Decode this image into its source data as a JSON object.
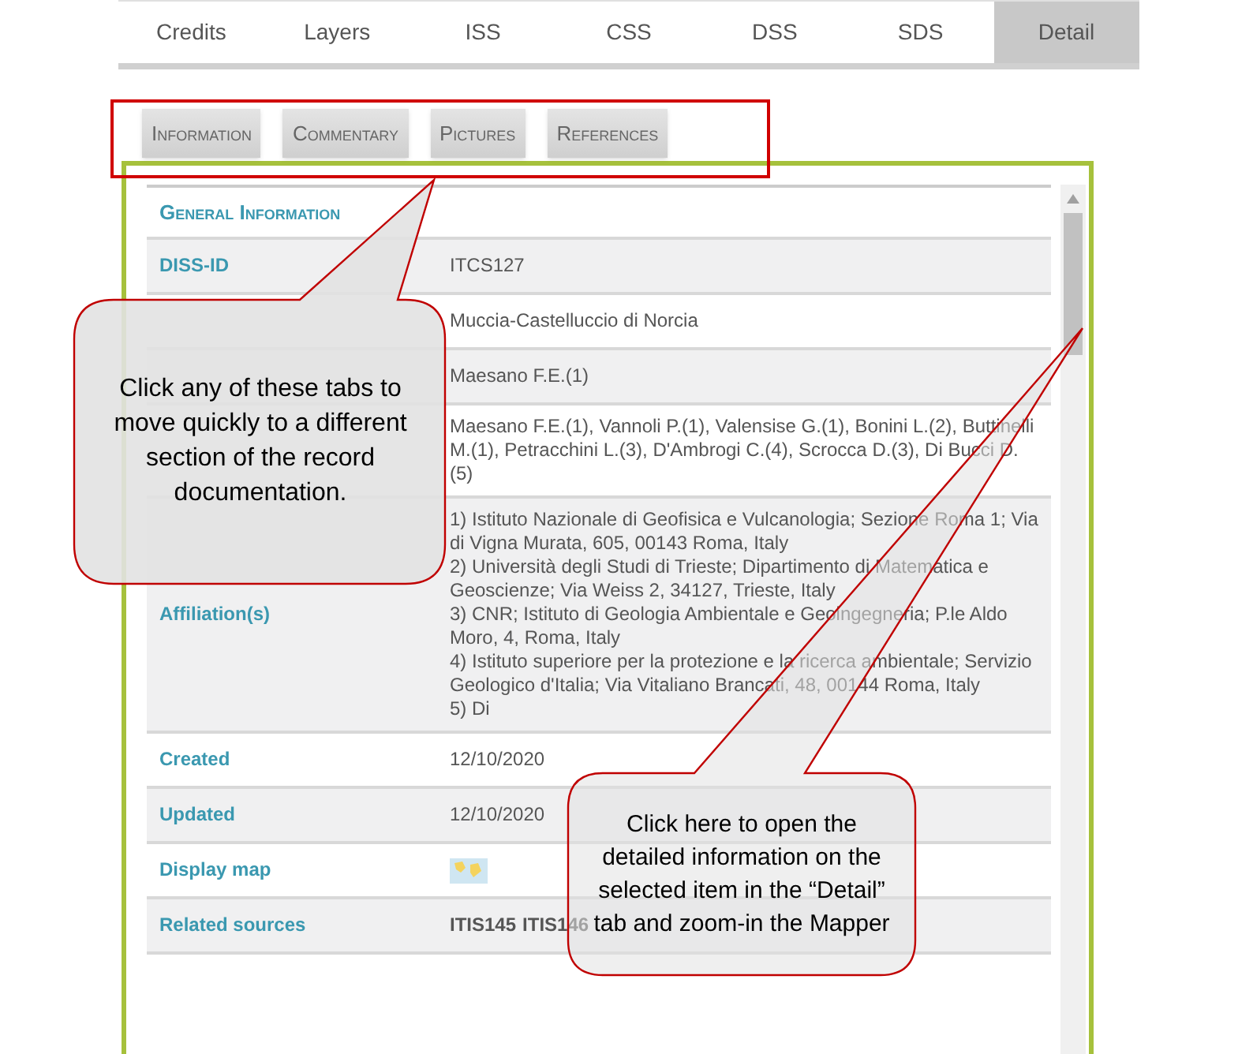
{
  "top_tabs": [
    {
      "label": "Credits",
      "selected": false
    },
    {
      "label": "Layers",
      "selected": false
    },
    {
      "label": "ISS",
      "selected": false
    },
    {
      "label": "CSS",
      "selected": false
    },
    {
      "label": "DSS",
      "selected": false
    },
    {
      "label": "SDS",
      "selected": false
    },
    {
      "label": "Detail",
      "selected": true
    }
  ],
  "section_tabs": [
    "Information",
    "Commentary",
    "Pictures",
    "References"
  ],
  "panel": {
    "heading": "General Information",
    "rows": [
      {
        "kind": "text",
        "label": "DISS-ID",
        "value": "ITCS127"
      },
      {
        "kind": "text",
        "value": "Muccia-Castelluccio di Norcia"
      },
      {
        "kind": "text",
        "value": "Maesano F.E.(1)"
      },
      {
        "kind": "text",
        "value": "Maesano F.E.(1), Vannoli P.(1), Valensise G.(1), Bonini L.(2), Buttinelli M.(1), Petracchini L.(3), D'Ambrogi C.(4), Scrocca D.(3), Di Bucci D.(5)"
      },
      {
        "kind": "lines",
        "label": "Affiliation(s)",
        "lines": [
          "1) Istituto Nazionale di Geofisica e Vulcanologia; Sezione Roma 1; Via di Vigna Murata, 605, 00143 Roma, Italy",
          "2) Università degli Studi di Trieste; Dipartimento di Matematica e Geoscienze; Via Weiss 2, 34127, Trieste, Italy",
          "3) CNR; Istituto di Geologia Ambientale e Geoingegneria; P.le Aldo Moro, 4, Roma, Italy",
          "4) Istituto superiore per la protezione e la ricerca ambientale; Servizio Geologico d'Italia; Via Vitaliano Brancati, 48, 00144 Roma, Italy",
          "5) Di"
        ]
      },
      {
        "kind": "text",
        "label": "Created",
        "value": "12/10/2020"
      },
      {
        "kind": "text",
        "label": "Updated",
        "value": "12/10/2020"
      },
      {
        "kind": "map",
        "label": "Display map"
      },
      {
        "kind": "links",
        "label": "Related sources",
        "links": [
          "ITIS145",
          "ITIS146"
        ]
      }
    ]
  },
  "callouts": [
    {
      "text": "Click any of these tabs to move quickly to a different section of the record documentation."
    },
    {
      "text": "Click here to open the detailed information on the selected item in the “Detail” tab and zoom-in the Mapper"
    }
  ]
}
